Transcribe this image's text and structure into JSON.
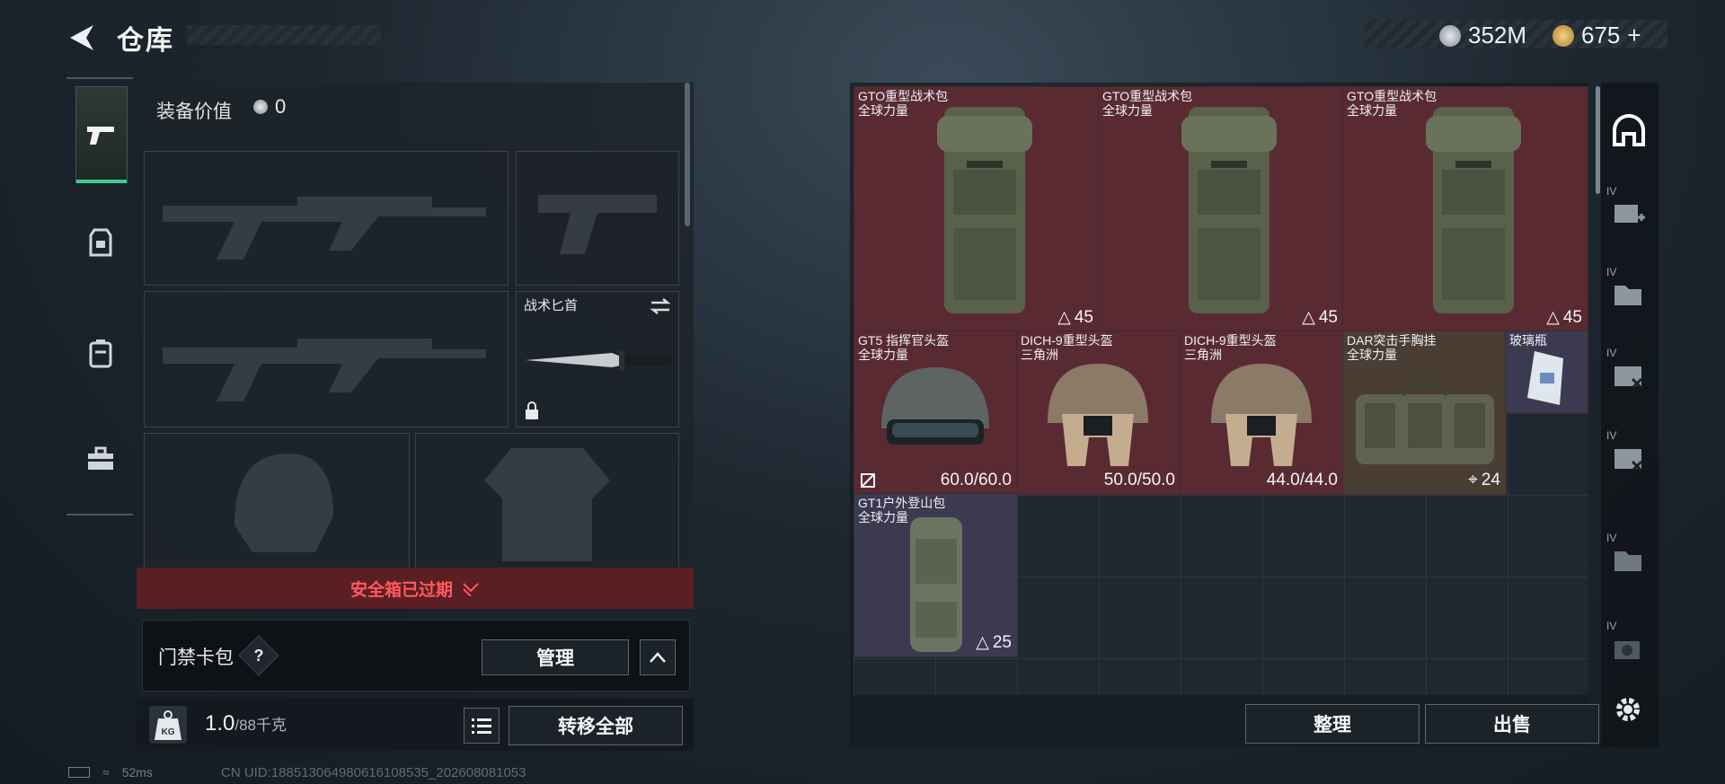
{
  "header": {
    "title": "仓库",
    "back_icon": "back-arrow-icon"
  },
  "currency": {
    "silver": "352M",
    "gold": "675",
    "gold_add": "+",
    "silver_color": "#b9c0c6",
    "gold_color": "#c9a24e"
  },
  "sidebar": {
    "items": [
      {
        "icon": "pistol-icon",
        "active": true
      },
      {
        "icon": "armor-rig-icon",
        "active": false
      },
      {
        "icon": "backpack-icon",
        "active": false
      },
      {
        "icon": "toolbox-icon",
        "active": false
      }
    ]
  },
  "equipment": {
    "value_label": "装备价值",
    "value": "0",
    "knife_label": "战术匕首"
  },
  "expired_banner": {
    "text": "安全箱已过期"
  },
  "card_pack": {
    "label": "门禁卡包",
    "help": "?",
    "manage": "管理"
  },
  "bottom": {
    "weight": "1.0",
    "capacity": "/88千克",
    "kg_icon": "KG",
    "transfer_all": "转移全部"
  },
  "grid_items": [
    {
      "name": "GTO重型战术包",
      "sub": "全球力量",
      "value": "45",
      "color": "red"
    },
    {
      "name": "GTO重型战术包",
      "sub": "全球力量",
      "value": "45",
      "color": "red"
    },
    {
      "name": "GTO重型战术包",
      "sub": "全球力量",
      "value": "45",
      "color": "red"
    },
    {
      "name": "GT5 指挥官头盔",
      "sub": "全球力量",
      "value": "60.0/60.0",
      "color": "red"
    },
    {
      "name": "DICH-9重型头盔",
      "sub": "三角洲",
      "value": "50.0/50.0",
      "color": "red"
    },
    {
      "name": "DICH-9重型头盔",
      "sub": "三角洲",
      "value": "44.0/44.0",
      "color": "red"
    },
    {
      "name": "DAR突击手胸挂",
      "sub": "全球力量",
      "value": "24",
      "color": "brown"
    },
    {
      "name": "玻璃瓶",
      "sub": "",
      "value": "",
      "color": "purple"
    },
    {
      "name": "GT1户外登山包",
      "sub": "全球力量",
      "value": "25",
      "color": "purple"
    }
  ],
  "filters": [
    {
      "icon": "home-base-icon",
      "tier": ""
    },
    {
      "icon": "medkit-add-icon",
      "tier": "IV"
    },
    {
      "icon": "folder-icon",
      "tier": "IV"
    },
    {
      "icon": "case-cross-icon",
      "tier": "IV"
    },
    {
      "icon": "case-cross-icon",
      "tier": "IV"
    },
    {
      "icon": "folder-check-icon",
      "tier": "IV"
    },
    {
      "icon": "camera-add-icon",
      "tier": "IV"
    }
  ],
  "actions": {
    "sort": "整理",
    "sell": "出售"
  },
  "status": {
    "ping": "52ms",
    "uid": "CN UID:188513064980616108535_202608081053"
  }
}
